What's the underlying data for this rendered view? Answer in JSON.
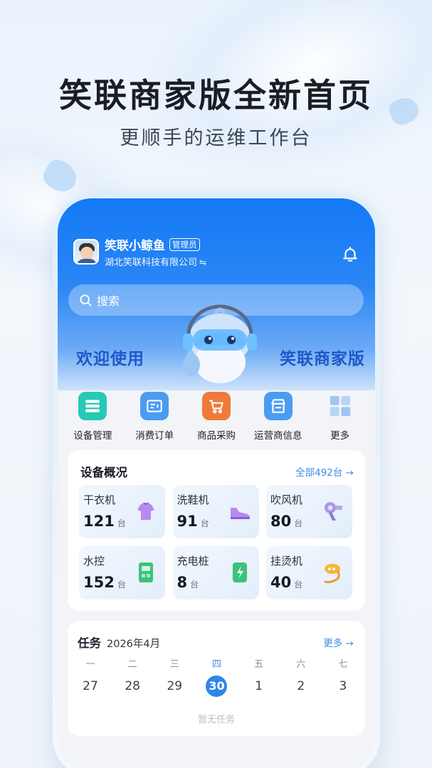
{
  "promo": {
    "headline": "笑联商家版全新首页",
    "subheadline": "更顺手的运维工作台"
  },
  "header": {
    "user_name": "笑联小鲸鱼",
    "role_badge": "管理员",
    "company": "湖北笑联科技有限公司",
    "switch_glyph": "⇋",
    "bell_icon": "bell-icon"
  },
  "search": {
    "placeholder": "搜索"
  },
  "banner": {
    "left_text": "欢迎使用",
    "right_text": "笑联商家版"
  },
  "quick_actions": [
    {
      "label": "设备管理",
      "icon": "device-management-icon",
      "color": "#26c9b4"
    },
    {
      "label": "消费订单",
      "icon": "order-icon",
      "color": "#4a9cf0"
    },
    {
      "label": "商品采购",
      "icon": "cart-icon",
      "color": "#f07a3a"
    },
    {
      "label": "运营商信息",
      "icon": "shop-icon",
      "color": "#4a9cf0"
    },
    {
      "label": "更多",
      "icon": "grid-icon",
      "color": "#9fc6f3"
    }
  ],
  "device_overview": {
    "title": "设备概况",
    "all_link": "全部492台 →",
    "unit": "台",
    "items": [
      {
        "name": "干衣机",
        "count": "121",
        "icon": "clothes-icon"
      },
      {
        "name": "洗鞋机",
        "count": "91",
        "icon": "shoe-icon"
      },
      {
        "name": "吹风机",
        "count": "80",
        "icon": "hair-dryer-icon"
      },
      {
        "name": "水控",
        "count": "152",
        "icon": "water-control-icon"
      },
      {
        "name": "充电桩",
        "count": "8",
        "icon": "charging-pile-icon"
      },
      {
        "name": "挂烫机",
        "count": "40",
        "icon": "garment-steamer-icon"
      }
    ]
  },
  "tasks": {
    "title": "任务",
    "month": "2026年4月",
    "more_link": "更多 →",
    "week": [
      {
        "day": "一",
        "date": "27"
      },
      {
        "day": "二",
        "date": "28"
      },
      {
        "day": "三",
        "date": "29"
      },
      {
        "day": "四",
        "date": "30",
        "active": true
      },
      {
        "day": "五",
        "date": "1"
      },
      {
        "day": "六",
        "date": "2"
      },
      {
        "day": "七",
        "date": "3"
      }
    ],
    "empty_text": "暂无任务"
  },
  "colors": {
    "brand_blue": "#1479f5",
    "accent": "#2f86ea",
    "banner_text": "#1f58c9"
  }
}
